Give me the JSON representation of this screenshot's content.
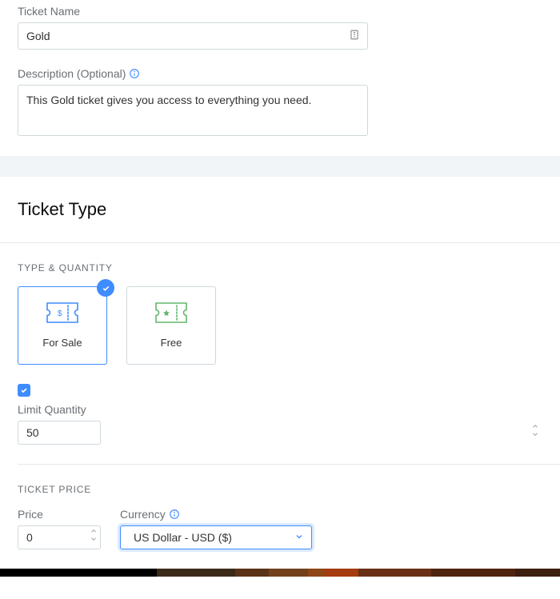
{
  "ticketName": {
    "label": "Ticket Name",
    "value": "Gold"
  },
  "description": {
    "label": "Description (Optional)",
    "value": "This Gold ticket gives you access to everything you need."
  },
  "ticketType": {
    "heading": "Ticket Type",
    "typeSection": {
      "label": "TYPE & QUANTITY",
      "options": {
        "forSale": {
          "label": "For Sale",
          "selected": true
        },
        "free": {
          "label": "Free",
          "selected": false
        }
      }
    },
    "limitQuantity": {
      "checked": true,
      "label": "Limit Quantity",
      "value": "50"
    },
    "priceSection": {
      "label": "TICKET PRICE",
      "price": {
        "label": "Price",
        "value": "0"
      },
      "currency": {
        "label": "Currency",
        "value": "US Dollar - USD ($)"
      }
    }
  }
}
